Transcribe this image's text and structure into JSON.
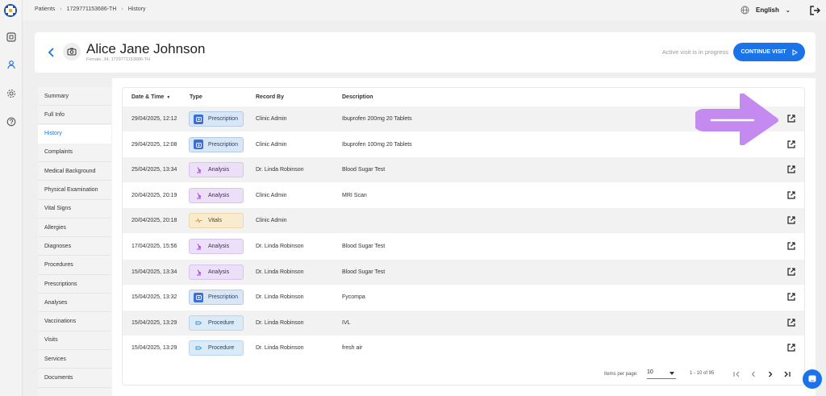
{
  "breadcrumbs": [
    "Patients",
    "1729771153686-TH",
    "History"
  ],
  "language": "English",
  "patient": {
    "name": "Alice Jane Johnson",
    "meta": "Female, 34, 1729771153686-TH"
  },
  "visit": {
    "status_text": "Active visit is in progress",
    "continue_label": "CONTINUE VISIT"
  },
  "menu": [
    {
      "label": "Summary",
      "active": false
    },
    {
      "label": "Full Info",
      "active": false
    },
    {
      "label": "History",
      "active": true
    },
    {
      "label": "Complaints",
      "active": false
    },
    {
      "label": "Medical Background",
      "active": false
    },
    {
      "label": "Physical Examination",
      "active": false
    },
    {
      "label": "Vital Signs",
      "active": false
    },
    {
      "label": "Allergies",
      "active": false
    },
    {
      "label": "Diagnoses",
      "active": false
    },
    {
      "label": "Procedures",
      "active": false
    },
    {
      "label": "Prescriptions",
      "active": false
    },
    {
      "label": "Analyses",
      "active": false
    },
    {
      "label": "Vaccinations",
      "active": false
    },
    {
      "label": "Visits",
      "active": false
    },
    {
      "label": "Services",
      "active": false
    },
    {
      "label": "Documents",
      "active": false
    }
  ],
  "table": {
    "headers": {
      "date": "Date & Time",
      "type": "Type",
      "record_by": "Record By",
      "description": "Description"
    },
    "rows": [
      {
        "date": "29/04/2025, 12:12",
        "type": "Prescription",
        "record_by": "Clinic Admin",
        "description": "Ibuprofen 200mg 20 Tablets"
      },
      {
        "date": "29/04/2025, 12:08",
        "type": "Prescription",
        "record_by": "Clinic Admin",
        "description": "Ibuprofen 100mg 20 Tablets"
      },
      {
        "date": "25/04/2025, 13:34",
        "type": "Analysis",
        "record_by": "Dr. Linda Robinson",
        "description": "Blood Sugar Test"
      },
      {
        "date": "20/04/2025, 20:19",
        "type": "Analysis",
        "record_by": "Clinic Admin",
        "description": "MRI Scan"
      },
      {
        "date": "20/04/2025, 20:18",
        "type": "Vitals",
        "record_by": "Clinic Admin",
        "description": ""
      },
      {
        "date": "17/04/2025, 15:56",
        "type": "Analysis",
        "record_by": "Dr. Linda Robinson",
        "description": "Blood Sugar Test"
      },
      {
        "date": "15/04/2025, 13:34",
        "type": "Analysis",
        "record_by": "Dr. Linda Robinson",
        "description": "Blood Sugar Test"
      },
      {
        "date": "15/04/2025, 13:32",
        "type": "Prescription",
        "record_by": "Dr. Linda Robinson",
        "description": "Fycompa"
      },
      {
        "date": "15/04/2025, 13:29",
        "type": "Procedure",
        "record_by": "Dr. Linda Robinson",
        "description": "IVL"
      },
      {
        "date": "15/04/2025, 13:29",
        "type": "Procedure",
        "record_by": "Dr. Linda Robinson",
        "description": "fresh air"
      }
    ]
  },
  "pagination": {
    "items_per_page_label": "Items per page:",
    "items_per_page": "10",
    "range": "1 - 10 of 95"
  },
  "colors": {
    "accent": "#1a73e8",
    "hint_arrow": "#c58af0"
  }
}
